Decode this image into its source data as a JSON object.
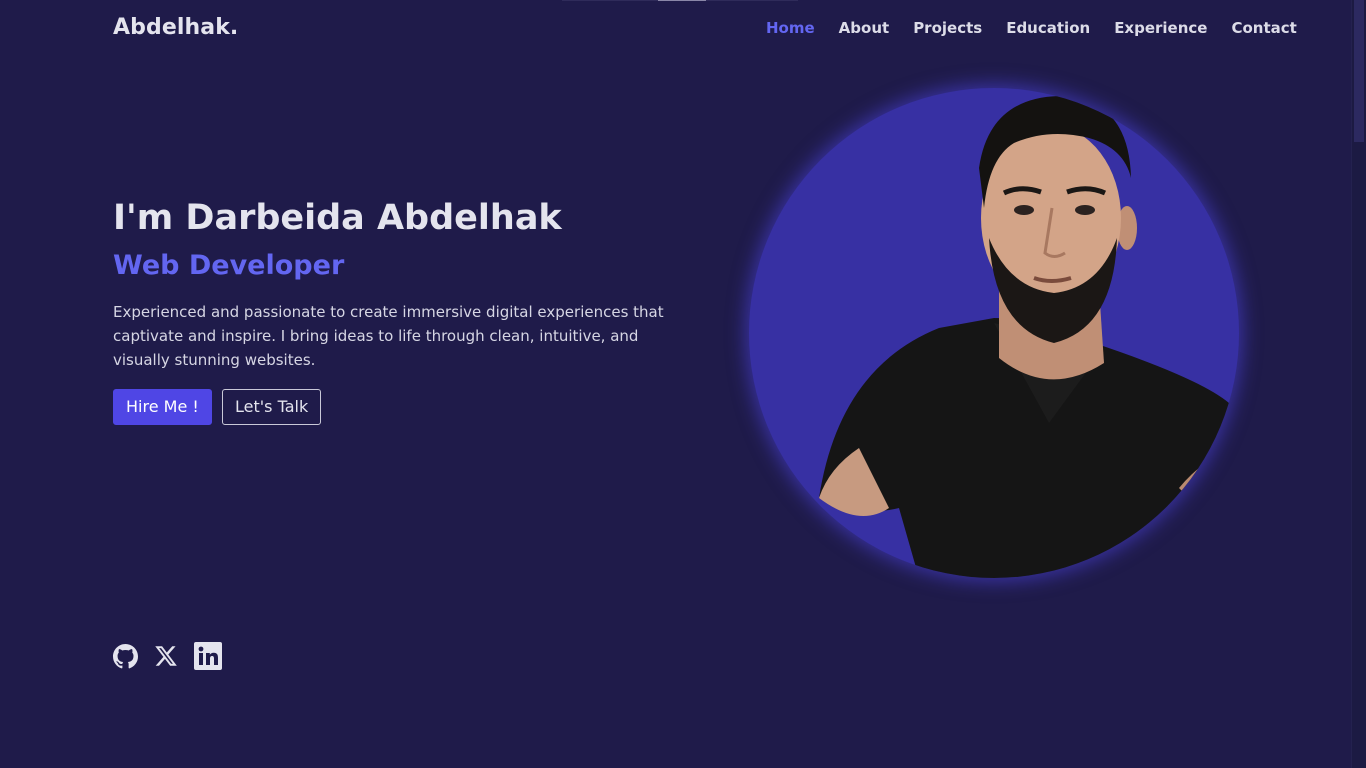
{
  "brand": {
    "name": "Abdelhak."
  },
  "nav": {
    "items": [
      {
        "label": "Home",
        "active": true
      },
      {
        "label": "About"
      },
      {
        "label": "Projects"
      },
      {
        "label": "Education"
      },
      {
        "label": "Experience"
      },
      {
        "label": "Contact"
      }
    ]
  },
  "hero": {
    "title": "I'm Darbeida Abdelhak",
    "role": "Web Developer",
    "description": "Experienced and passionate to create immersive digital experiences that captivate and inspire. I bring ideas to life through clean, intuitive, and visually stunning websites.",
    "primary_button": "Hire Me !",
    "secondary_button": "Let's Talk"
  },
  "socials": [
    {
      "icon": "github-icon"
    },
    {
      "icon": "x-twitter-icon"
    },
    {
      "icon": "linkedin-icon"
    }
  ],
  "colors": {
    "background": "#1f1b4a",
    "accent": "#6366f1",
    "button": "#4f46e5",
    "portrait_bg": "#3730a3"
  }
}
